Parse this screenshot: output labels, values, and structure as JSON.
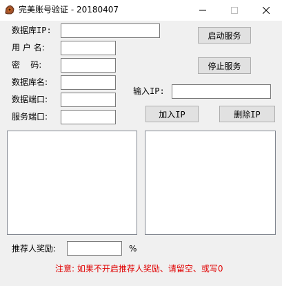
{
  "window": {
    "title": "完美账号验证 - 20180407",
    "icon": "app-logo-icon",
    "controls": [
      "minimize-icon",
      "maximize-icon",
      "close-icon"
    ]
  },
  "form": {
    "db_ip_label": "数据库IP:",
    "db_ip_value": "",
    "username_label": "用 户 名:",
    "username_value": "",
    "password_label": "密    码:",
    "password_value": "",
    "db_name_label": "数据库名:",
    "db_name_value": "",
    "db_port_label": "数据端口:",
    "db_port_value": "",
    "service_port_label": "服务端口:",
    "service_port_value": ""
  },
  "buttons": {
    "start_service": "启动服务",
    "stop_service": "停止服务",
    "add_ip": "加入IP",
    "delete_ip": "删除IP"
  },
  "ip_input": {
    "label": "输入IP:",
    "value": ""
  },
  "lists": {
    "left_items": [],
    "right_items": []
  },
  "reward": {
    "label": "推荐人奖励:",
    "value": "",
    "unit": "%"
  },
  "note": "注意: 如果不开启推荐人奖励、请留空、或写0",
  "colors": {
    "note_text": "#e00000",
    "background": "#f0f0f0",
    "titlebar": "#ffffff"
  }
}
